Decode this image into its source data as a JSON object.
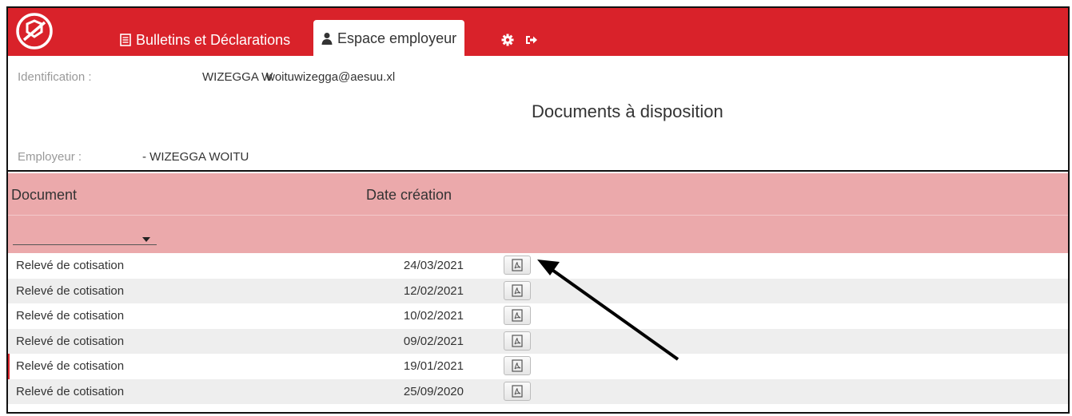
{
  "nav": {
    "tabs": [
      {
        "label": "Bulletins et Déclarations",
        "icon": "document-icon"
      },
      {
        "label": "Espace employeur",
        "icon": "user-icon"
      }
    ],
    "settings_icon": "gear-icon",
    "logout_icon": "logout-icon",
    "brand_color": "#d9222a"
  },
  "info": {
    "identification_label": "Identification :",
    "identification_name": "WIZEGGA W",
    "identification_email": "woituwizegga@aesuu.xl",
    "employeur_label": "Employeur :",
    "employeur_value": "- WIZEGGA WOITU",
    "title": "Documents à disposition"
  },
  "table": {
    "headers": {
      "document": "Document",
      "date": "Date création"
    },
    "filter_value": "",
    "header_color": "#eba9ab",
    "rows": [
      {
        "document": "Relevé de cotisation",
        "date": "24/03/2021"
      },
      {
        "document": "Relevé de cotisation",
        "date": "12/02/2021"
      },
      {
        "document": "Relevé de cotisation",
        "date": "10/02/2021"
      },
      {
        "document": "Relevé de cotisation",
        "date": "09/02/2021"
      },
      {
        "document": "Relevé de cotisation",
        "date": "19/01/2021"
      },
      {
        "document": "Relevé de cotisation",
        "date": "25/09/2020"
      }
    ]
  }
}
